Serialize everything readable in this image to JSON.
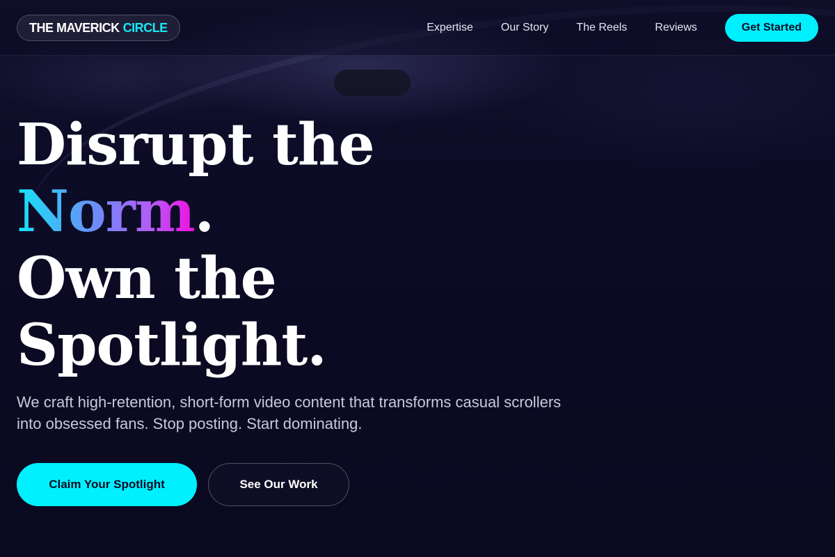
{
  "header": {
    "logo": {
      "main": "THE MAVERICK",
      "accent": "CIRCLE"
    },
    "nav": [
      {
        "label": "Expertise"
      },
      {
        "label": "Our Story"
      },
      {
        "label": "The Reels"
      },
      {
        "label": "Reviews"
      }
    ],
    "cta_label": "Get Started"
  },
  "hero": {
    "title_line1": "Disrupt the",
    "title_gradient_word": "Norm",
    "title_period": ".",
    "title_line3": "Own the",
    "title_line4": "Spotlight.",
    "subtitle": "We craft high-retention, short-form video content that transforms casual scrollers into obsessed fans. Stop posting. Start dominating.",
    "primary_button": "Claim Your Spotlight",
    "secondary_button": "See Our Work"
  },
  "colors": {
    "background": "#0b0a22",
    "accent": "#00f0ff",
    "gradient_start": "#14e4f6",
    "gradient_end": "#f20fe2"
  }
}
